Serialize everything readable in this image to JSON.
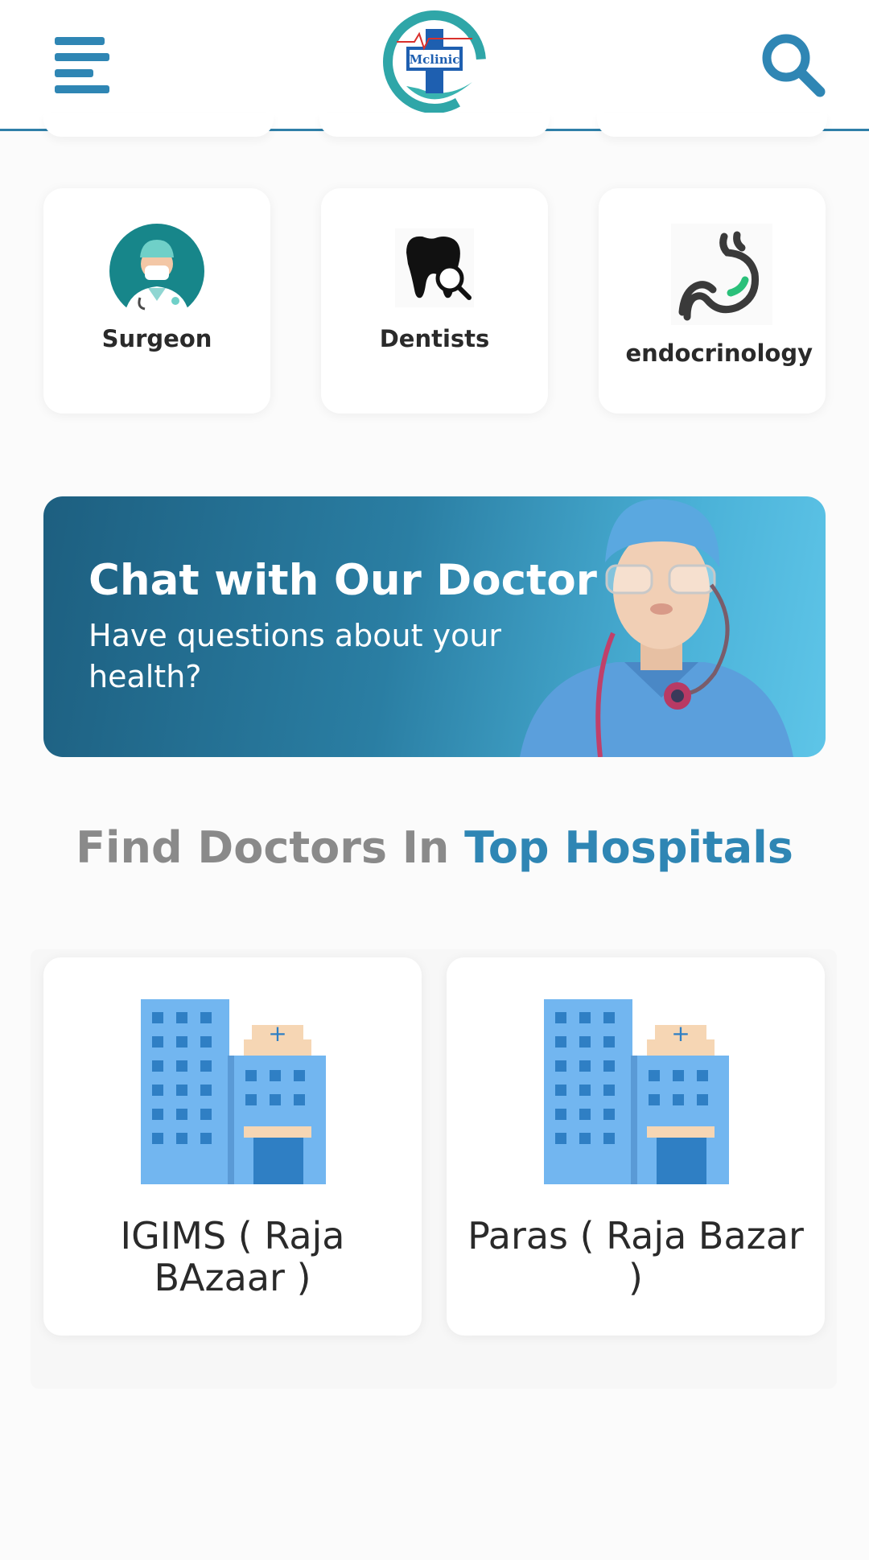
{
  "header": {
    "menu_icon": "hamburger-menu-icon",
    "logo_text": "Mclinic",
    "search_icon": "search-icon",
    "accent_color": "#2f86b4"
  },
  "specialities": [
    {
      "label": "Surgeon",
      "icon": "surgeon-icon"
    },
    {
      "label": "Dentists",
      "icon": "tooth-search-icon"
    },
    {
      "label": "endocrinology",
      "icon": "stomach-icon"
    }
  ],
  "banner": {
    "title": "Chat with Our Doctor",
    "subtitle": "Have questions about your health?"
  },
  "hospitals_section": {
    "title_part1": "Find Doctors In",
    "title_part2": "Top Hospitals",
    "items": [
      {
        "name": "IGIMS ( Raja BAzaar )",
        "icon": "hospital-building-icon"
      },
      {
        "name": "Paras ( Raja Bazar )",
        "icon": "hospital-building-icon"
      }
    ]
  }
}
